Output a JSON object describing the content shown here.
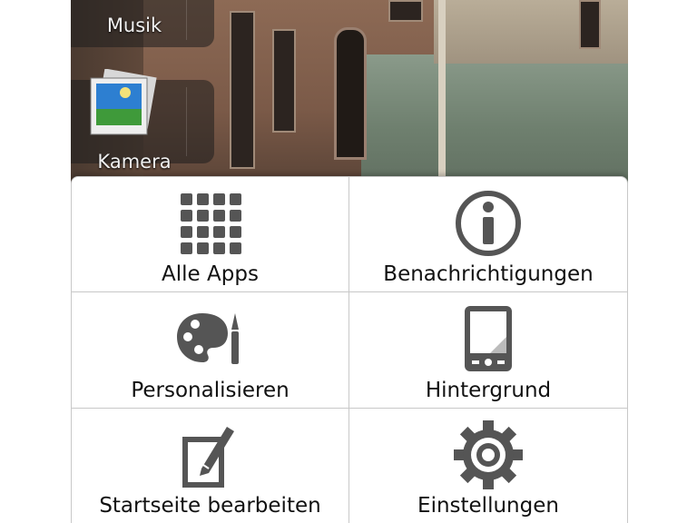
{
  "shortcuts": [
    {
      "label": "Musik",
      "icon": "music-icon"
    },
    {
      "label": "Kamera",
      "icon": "camera-icon"
    }
  ],
  "menu": {
    "items": [
      {
        "label": "Alle Apps",
        "icon": "app-grid-icon"
      },
      {
        "label": "Benachrichtigungen",
        "icon": "info-icon"
      },
      {
        "label": "Personalisieren",
        "icon": "palette-icon"
      },
      {
        "label": "Hintergrund",
        "icon": "phone-wallpaper-icon"
      },
      {
        "label": "Startseite bearbeiten",
        "icon": "edit-icon"
      },
      {
        "label": "Einstellungen",
        "icon": "gear-icon"
      }
    ]
  },
  "colors": {
    "icon": "#555555",
    "menu_background": "#ffffff",
    "divider": "#c8c8c8"
  }
}
